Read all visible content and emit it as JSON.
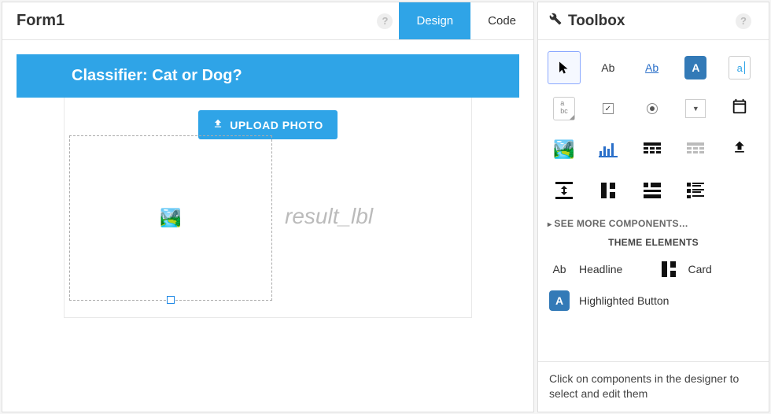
{
  "form_title": "Form1",
  "tabs": {
    "design": "Design",
    "code": "Code"
  },
  "form": {
    "heading": "Classifier: Cat or Dog?",
    "upload_button": "UPLOAD PHOTO",
    "result_placeholder": "result_lbl"
  },
  "toolbox": {
    "title": "Toolbox",
    "see_more": "SEE MORE COMPONENTS…",
    "theme_header": "THEME ELEMENTS",
    "theme": {
      "headline": "Headline",
      "card": "Card",
      "highlighted_button": "Highlighted Button"
    },
    "tools": {
      "cursor": "cursor",
      "label": "Ab",
      "link": "Ab",
      "button": "A",
      "textbox": "a",
      "textarea": "a\nbc",
      "checkbox": "✓",
      "radio": "radio",
      "dropdown": "▼",
      "date": "date",
      "image": "image",
      "chart": "chart",
      "datagrid": "datagrid",
      "repeater": "repeater",
      "fileupload": "upload",
      "spacer": "spacer",
      "column1": "col1",
      "column2": "col2",
      "column3": "col3"
    }
  },
  "footer_hint": "Click on components in the designer to select and edit them"
}
